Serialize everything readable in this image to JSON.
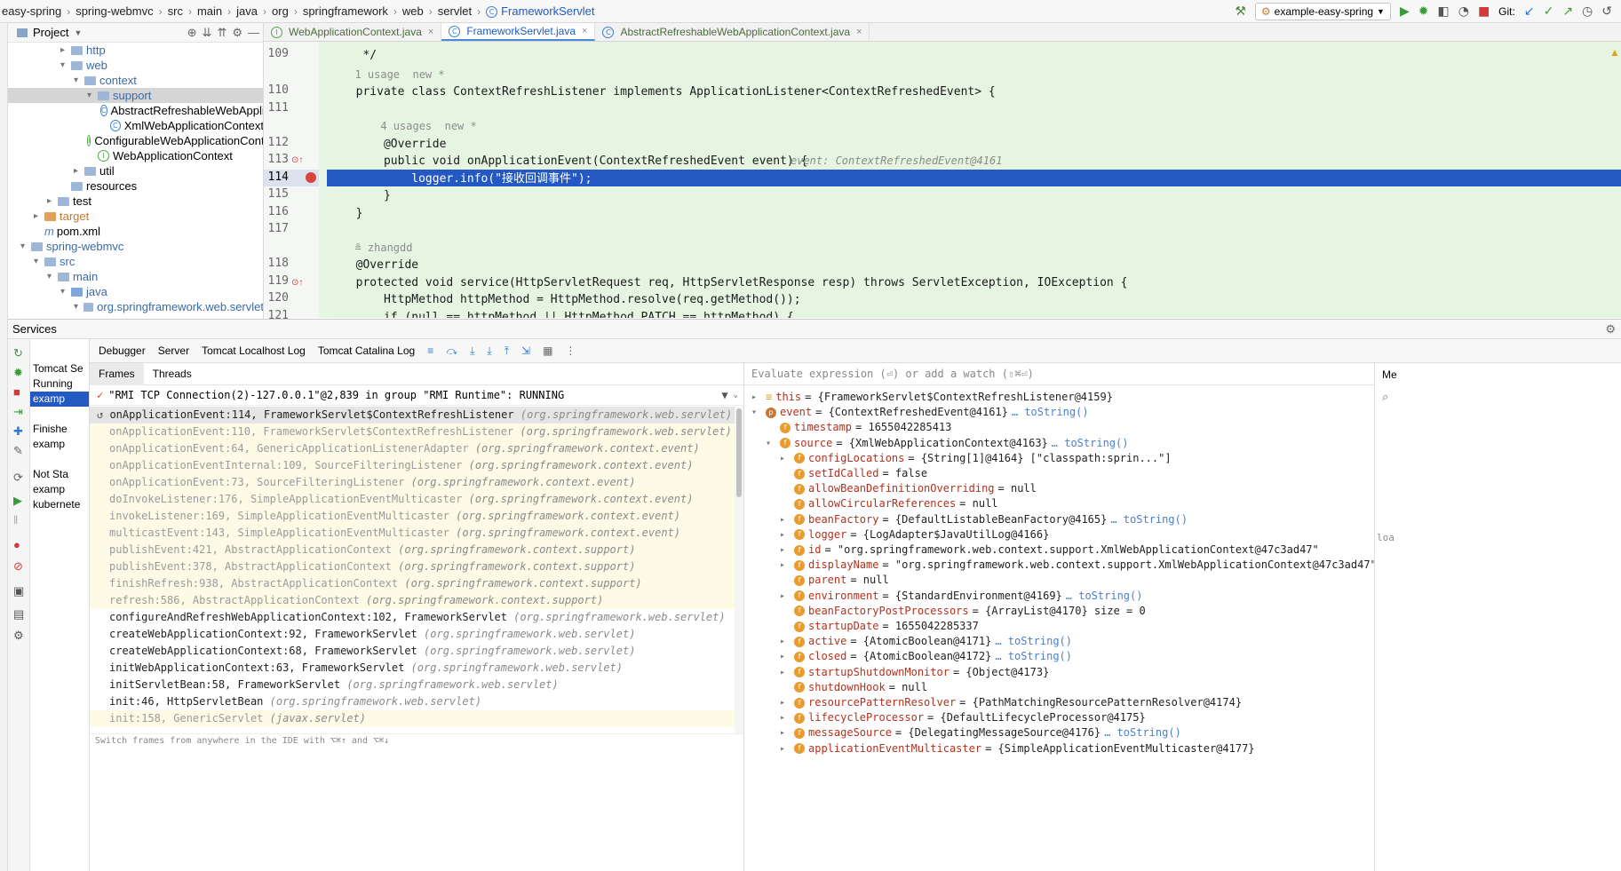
{
  "breadcrumb": [
    "easy-spring",
    "spring-webmvc",
    "src",
    "main",
    "java",
    "org",
    "springframework",
    "web",
    "servlet",
    "FrameworkServlet"
  ],
  "toolbar": {
    "run_config": "example-easy-spring",
    "git_label": "Git:"
  },
  "project": {
    "title": "Project",
    "tree": [
      {
        "label": "http",
        "indent": 3,
        "arrow": "▸",
        "icon": "folder"
      },
      {
        "label": "web",
        "indent": 3,
        "arrow": "▾",
        "icon": "folder"
      },
      {
        "label": "context",
        "indent": 4,
        "arrow": "▾",
        "icon": "folder"
      },
      {
        "label": "support",
        "indent": 5,
        "arrow": "▾",
        "icon": "folder",
        "selected": true
      },
      {
        "label": "AbstractRefreshableWebApplicationContext",
        "indent": 6,
        "arrow": "",
        "icon": "class"
      },
      {
        "label": "XmlWebApplicationContext",
        "indent": 6,
        "arrow": "",
        "icon": "class"
      },
      {
        "label": "ConfigurableWebApplicationContext",
        "indent": 5,
        "arrow": "",
        "icon": "iface"
      },
      {
        "label": "WebApplicationContext",
        "indent": 5,
        "arrow": "",
        "icon": "iface"
      },
      {
        "label": "util",
        "indent": 4,
        "arrow": "▸",
        "icon": "folder"
      },
      {
        "label": "resources",
        "indent": 3,
        "arrow": "",
        "icon": "folder"
      },
      {
        "label": "test",
        "indent": 2,
        "arrow": "▸",
        "icon": "folder"
      },
      {
        "label": "target",
        "indent": 1,
        "arrow": "▸",
        "icon": "orange"
      },
      {
        "label": "pom.xml",
        "indent": 1,
        "arrow": "",
        "icon": "m"
      },
      {
        "label": "spring-webmvc",
        "indent": 0,
        "arrow": "▾",
        "icon": "folder"
      },
      {
        "label": "src",
        "indent": 1,
        "arrow": "▾",
        "icon": "folder"
      },
      {
        "label": "main",
        "indent": 2,
        "arrow": "▾",
        "icon": "folder"
      },
      {
        "label": "java",
        "indent": 3,
        "arrow": "▾",
        "icon": "src"
      },
      {
        "label": "org.springframework.web.servlet",
        "indent": 4,
        "arrow": "▾",
        "icon": "folder"
      }
    ]
  },
  "editor": {
    "tabs": [
      {
        "label": "WebApplicationContext.java",
        "icon": "I"
      },
      {
        "label": "FrameworkServlet.java",
        "icon": "C",
        "active": true
      },
      {
        "label": "AbstractRefreshableWebApplicationContext.java",
        "icon": "C"
      }
    ],
    "lines": [
      {
        "num": "109",
        "text": "   */"
      },
      {
        "num": "",
        "text": "  1 usage  new *",
        "meta": true
      },
      {
        "num": "110",
        "text": "  private class ContextRefreshListener implements ApplicationListener<ContextRefreshedEvent> {"
      },
      {
        "num": "111",
        "text": ""
      },
      {
        "num": "",
        "text": "      4 usages  new *",
        "meta": true
      },
      {
        "num": "112",
        "text": "      @Override"
      },
      {
        "num": "113",
        "text": "      public void onApplicationEvent(ContextRefreshedEvent event) {",
        "hint": "event: ContextRefreshedEvent@4161"
      },
      {
        "num": "114",
        "text": "          logger.info(\"接收回调事件\");",
        "current": true
      },
      {
        "num": "115",
        "text": "      }"
      },
      {
        "num": "116",
        "text": "  }"
      },
      {
        "num": "117",
        "text": ""
      },
      {
        "num": "",
        "text": "  ≗ zhangdd",
        "meta": true
      },
      {
        "num": "118",
        "text": "  @Override"
      },
      {
        "num": "119",
        "text": "  protected void service(HttpServletRequest req, HttpServletResponse resp) throws ServletException, IOException {"
      },
      {
        "num": "120",
        "text": "      HttpMethod httpMethod = HttpMethod.resolve(req.getMethod());"
      },
      {
        "num": "121",
        "text": "      if (null == httpMethod || HttpMethod.PATCH == httpMethod) {"
      }
    ]
  },
  "services": {
    "title": "Services",
    "tree": [
      "Tomcat Se",
      "Running",
      "examp",
      "",
      "Finishe",
      "examp",
      "",
      "Not Sta",
      "examp",
      "kubernete"
    ],
    "debug_tabs": [
      "Debugger",
      "Server",
      "Tomcat Localhost Log",
      "Tomcat Catalina Log"
    ],
    "frame_tabs": [
      "Frames",
      "Threads"
    ],
    "thread": "\"RMI TCP Connection(2)-127.0.0.1\"@2,839 in group \"RMI Runtime\": RUNNING",
    "frames": [
      {
        "m": "onApplicationEvent:114, FrameworkServlet$ContextRefreshListener",
        "p": "(org.springframework.web.servlet)",
        "sel": true
      },
      {
        "m": "onApplicationEvent:110, FrameworkServlet$ContextRefreshListener",
        "p": "(org.springframework.web.servlet)",
        "lib": true
      },
      {
        "m": "onApplicationEvent:64, GenericApplicationListenerAdapter",
        "p": "(org.springframework.context.event)",
        "lib": true
      },
      {
        "m": "onApplicationEventInternal:109, SourceFilteringListener",
        "p": "(org.springframework.context.event)",
        "lib": true
      },
      {
        "m": "onApplicationEvent:73, SourceFilteringListener",
        "p": "(org.springframework.context.event)",
        "lib": true
      },
      {
        "m": "doInvokeListener:176, SimpleApplicationEventMulticaster",
        "p": "(org.springframework.context.event)",
        "lib": true
      },
      {
        "m": "invokeListener:169, SimpleApplicationEventMulticaster",
        "p": "(org.springframework.context.event)",
        "lib": true
      },
      {
        "m": "multicastEvent:143, SimpleApplicationEventMulticaster",
        "p": "(org.springframework.context.event)",
        "lib": true
      },
      {
        "m": "publishEvent:421, AbstractApplicationContext",
        "p": "(org.springframework.context.support)",
        "lib": true
      },
      {
        "m": "publishEvent:378, AbstractApplicationContext",
        "p": "(org.springframework.context.support)",
        "lib": true
      },
      {
        "m": "finishRefresh:938, AbstractApplicationContext",
        "p": "(org.springframework.context.support)",
        "lib": true
      },
      {
        "m": "refresh:586, AbstractApplicationContext",
        "p": "(org.springframework.context.support)",
        "lib": true
      },
      {
        "m": "configureAndRefreshWebApplicationContext:102, FrameworkServlet",
        "p": "(org.springframework.web.servlet)"
      },
      {
        "m": "createWebApplicationContext:92, FrameworkServlet",
        "p": "(org.springframework.web.servlet)"
      },
      {
        "m": "createWebApplicationContext:68, FrameworkServlet",
        "p": "(org.springframework.web.servlet)"
      },
      {
        "m": "initWebApplicationContext:63, FrameworkServlet",
        "p": "(org.springframework.web.servlet)"
      },
      {
        "m": "initServletBean:58, FrameworkServlet",
        "p": "(org.springframework.web.servlet)"
      },
      {
        "m": "init:46, HttpServletBean",
        "p": "(org.springframework.web.servlet)"
      },
      {
        "m": "init:158, GenericServlet",
        "p": "(javax.servlet)",
        "lib": true
      }
    ],
    "frames_footer": "Switch frames from anywhere in the IDE with ⌥⌘↑ and ⌥⌘↓",
    "eval_placeholder": "Evaluate expression (⏎) or add a watch (⇧⌘⏎)",
    "variables": [
      {
        "n": "this",
        "v": "= {FrameworkServlet$ContextRefreshListener@4159}",
        "lvl": 0,
        "badge": "≡",
        "exp": "▸"
      },
      {
        "n": "event",
        "v": "= {ContextRefreshedEvent@4161}",
        "link": "… toString()",
        "lvl": 0,
        "badge": "p",
        "exp": "▾"
      },
      {
        "n": "timestamp",
        "v": "= 1655042285413",
        "lvl": 1,
        "badge": "f",
        "exp": ""
      },
      {
        "n": "source",
        "v": "= {XmlWebApplicationContext@4163}",
        "link": "… toString()",
        "lvl": 1,
        "badge": "f",
        "exp": "▾"
      },
      {
        "n": "configLocations",
        "v": "= {String[1]@4164} [\"classpath:sprin...\"]",
        "lvl": 2,
        "badge": "f",
        "exp": "▸"
      },
      {
        "n": "setIdCalled",
        "v": "= false",
        "lvl": 2,
        "badge": "f",
        "exp": ""
      },
      {
        "n": "allowBeanDefinitionOverriding",
        "v": "= null",
        "lvl": 2,
        "badge": "f",
        "exp": ""
      },
      {
        "n": "allowCircularReferences",
        "v": "= null",
        "lvl": 2,
        "badge": "f",
        "exp": ""
      },
      {
        "n": "beanFactory",
        "v": "= {DefaultListableBeanFactory@4165}",
        "link": "… toString()",
        "lvl": 2,
        "badge": "f",
        "exp": "▸"
      },
      {
        "n": "logger",
        "v": "= {LogAdapter$JavaUtilLog@4166}",
        "lvl": 2,
        "badge": "f",
        "exp": "▸"
      },
      {
        "n": "id",
        "v": "= \"org.springframework.web.context.support.XmlWebApplicationContext@47c3ad47\"",
        "lvl": 2,
        "badge": "f",
        "exp": "▸"
      },
      {
        "n": "displayName",
        "v": "= \"org.springframework.web.context.support.XmlWebApplicationContext@47c3ad47\"",
        "lvl": 2,
        "badge": "f",
        "exp": "▸"
      },
      {
        "n": "parent",
        "v": "= null",
        "lvl": 2,
        "badge": "f",
        "exp": ""
      },
      {
        "n": "environment",
        "v": "= {StandardEnvironment@4169}",
        "link": "… toString()",
        "lvl": 2,
        "badge": "f",
        "exp": "▸"
      },
      {
        "n": "beanFactoryPostProcessors",
        "v": "= {ArrayList@4170}  size = 0",
        "lvl": 2,
        "badge": "f",
        "exp": ""
      },
      {
        "n": "startupDate",
        "v": "= 1655042285337",
        "lvl": 2,
        "badge": "f",
        "exp": ""
      },
      {
        "n": "active",
        "v": "= {AtomicBoolean@4171}",
        "link": "… toString()",
        "lvl": 2,
        "badge": "f",
        "exp": "▸"
      },
      {
        "n": "closed",
        "v": "= {AtomicBoolean@4172}",
        "link": "… toString()",
        "lvl": 2,
        "badge": "f",
        "exp": "▸"
      },
      {
        "n": "startupShutdownMonitor",
        "v": "= {Object@4173}",
        "lvl": 2,
        "badge": "f",
        "exp": "▸"
      },
      {
        "n": "shutdownHook",
        "v": "= null",
        "lvl": 2,
        "badge": "f",
        "exp": ""
      },
      {
        "n": "resourcePatternResolver",
        "v": "= {PathMatchingResourcePatternResolver@4174}",
        "lvl": 2,
        "badge": "f",
        "exp": "▸"
      },
      {
        "n": "lifecycleProcessor",
        "v": "= {DefaultLifecycleProcessor@4175}",
        "lvl": 2,
        "badge": "f",
        "exp": "▸"
      },
      {
        "n": "messageSource",
        "v": "= {DelegatingMessageSource@4176}",
        "link": "… toString()",
        "lvl": 2,
        "badge": "f",
        "exp": "▸"
      },
      {
        "n": "applicationEventMulticaster",
        "v": "= {SimpleApplicationEventMulticaster@4177}",
        "lvl": 2,
        "badge": "f",
        "exp": "▸"
      }
    ],
    "right_strip_label": "Me",
    "right_strip_text": "loa"
  }
}
